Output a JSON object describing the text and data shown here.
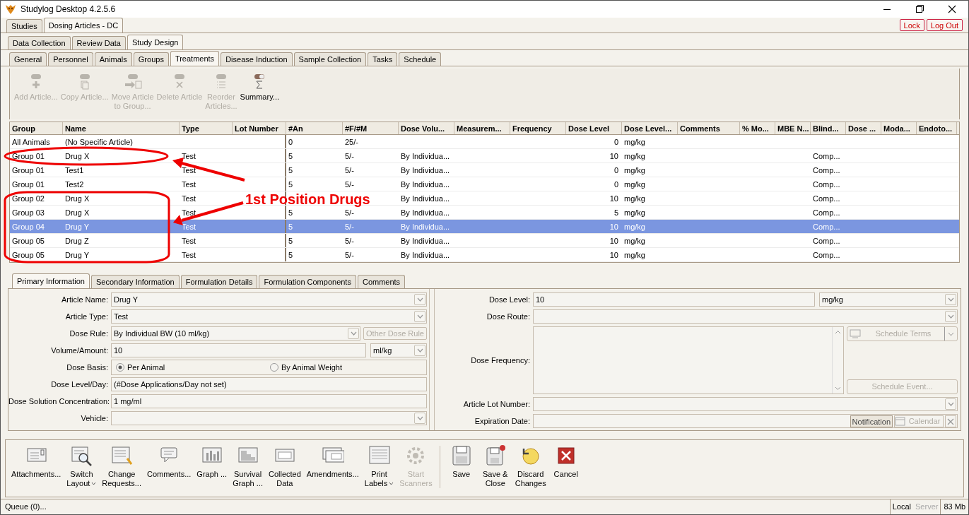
{
  "window": {
    "title": "Studylog Desktop 4.2.5.6"
  },
  "top_tabs": [
    {
      "label": "Studies",
      "selected": false
    },
    {
      "label": "Dosing Articles - DC",
      "selected": true
    }
  ],
  "session_buttons": [
    "Lock",
    "Log Out"
  ],
  "mode_tabs": [
    {
      "label": "Data Collection",
      "selected": false
    },
    {
      "label": "Review Data",
      "selected": false
    },
    {
      "label": "Study Design",
      "selected": true
    }
  ],
  "design_tabs": [
    {
      "label": "General",
      "selected": false
    },
    {
      "label": "Personnel",
      "selected": false
    },
    {
      "label": "Animals",
      "selected": false
    },
    {
      "label": "Groups",
      "selected": false
    },
    {
      "label": "Treatments",
      "selected": true
    },
    {
      "label": "Disease Induction",
      "selected": false
    },
    {
      "label": "Sample Collection",
      "selected": false
    },
    {
      "label": "Tasks",
      "selected": false
    },
    {
      "label": "Schedule",
      "selected": false
    }
  ],
  "toolbar": [
    {
      "label": [
        "Add Article..."
      ],
      "disabled": true
    },
    {
      "label": [
        "Copy Article..."
      ],
      "disabled": true
    },
    {
      "label": [
        "Move Article",
        "to Group..."
      ],
      "disabled": true
    },
    {
      "label": [
        "Delete Article"
      ],
      "disabled": true
    },
    {
      "label": [
        "Reorder",
        "Articles..."
      ],
      "disabled": true
    },
    {
      "label": [
        "Summary..."
      ],
      "disabled": false
    }
  ],
  "table": {
    "columns": [
      "Group",
      "Name",
      "Type",
      "Lot Number",
      "#An",
      "#F/#M",
      "Dose Volu...",
      "Measurem...",
      "Frequency",
      "Dose Level",
      "Dose Level...",
      "Comments",
      "% Mo...",
      "MBE N...",
      "Blind...",
      "Dose ...",
      "Moda...",
      "Endoto..."
    ],
    "rows": [
      {
        "selected": false,
        "cells": [
          "All Animals",
          "(No Specific Article)",
          "",
          "",
          "0",
          "25/-",
          "",
          "",
          "",
          "0",
          "mg/kg",
          "",
          "",
          "",
          "",
          "",
          "",
          ""
        ]
      },
      {
        "selected": false,
        "cells": [
          "Group 01",
          "Drug X",
          "Test",
          "",
          "5",
          "5/-",
          "By Individua...",
          "",
          "",
          "10",
          "mg/kg",
          "",
          "",
          "",
          "Comp...",
          "",
          "",
          ""
        ]
      },
      {
        "selected": false,
        "cells": [
          "Group 01",
          "Test1",
          "Test",
          "",
          "5",
          "5/-",
          "By Individua...",
          "",
          "",
          "0",
          "mg/kg",
          "",
          "",
          "",
          "Comp...",
          "",
          "",
          ""
        ]
      },
      {
        "selected": false,
        "cells": [
          "Group 01",
          "Test2",
          "Test",
          "",
          "5",
          "5/-",
          "By Individua...",
          "",
          "",
          "0",
          "mg/kg",
          "",
          "",
          "",
          "Comp...",
          "",
          "",
          ""
        ]
      },
      {
        "selected": false,
        "cells": [
          "Group 02",
          "Drug X",
          "Test",
          "",
          "",
          "",
          "By Individua...",
          "",
          "",
          "10",
          "mg/kg",
          "",
          "",
          "",
          "Comp...",
          "",
          "",
          ""
        ]
      },
      {
        "selected": false,
        "cells": [
          "Group 03",
          "Drug X",
          "Test",
          "",
          "5",
          "5/-",
          "By Individua...",
          "",
          "",
          "5",
          "mg/kg",
          "",
          "",
          "",
          "Comp...",
          "",
          "",
          ""
        ]
      },
      {
        "selected": true,
        "cells": [
          "Group 04",
          "Drug Y",
          "Test",
          "",
          "5",
          "5/-",
          "By Individua...",
          "",
          "",
          "10",
          "mg/kg",
          "",
          "",
          "",
          "Comp...",
          "",
          "",
          ""
        ]
      },
      {
        "selected": false,
        "cells": [
          "Group 05",
          "Drug Z",
          "Test",
          "",
          "5",
          "5/-",
          "By Individua...",
          "",
          "",
          "10",
          "mg/kg",
          "",
          "",
          "",
          "Comp...",
          "",
          "",
          ""
        ]
      },
      {
        "selected": false,
        "cells": [
          "Group 05",
          "Drug Y",
          "Test",
          "",
          "5",
          "5/-",
          "By Individua...",
          "",
          "",
          "10",
          "mg/kg",
          "",
          "",
          "",
          "Comp...",
          "",
          "",
          ""
        ]
      }
    ]
  },
  "detail_tabs": [
    {
      "label": "Primary Information",
      "selected": true
    },
    {
      "label": "Secondary Information",
      "selected": false
    },
    {
      "label": "Formulation Details",
      "selected": false
    },
    {
      "label": "Formulation Components",
      "selected": false
    },
    {
      "label": "Comments",
      "selected": false
    }
  ],
  "left_fields": [
    {
      "kind": "combo",
      "label": "Article Name:",
      "value": "Drug Y"
    },
    {
      "kind": "combo",
      "label": "Article Type:",
      "value": "Test"
    },
    {
      "kind": "combo_button",
      "label": "Dose Rule:",
      "value": "By Individual BW (10 ml/kg)",
      "button": "Other Dose Rule"
    },
    {
      "kind": "text_unit",
      "label": "Volume/Amount:",
      "value": "10",
      "unit": "ml/kg"
    },
    {
      "kind": "radio",
      "label": "Dose Basis:",
      "options": [
        {
          "label": "Per Animal",
          "selected": true
        },
        {
          "label": "By Animal Weight",
          "selected": false
        }
      ]
    },
    {
      "kind": "text",
      "label": "Dose Level/Day:",
      "value": "(#Dose Applications/Day not set)"
    },
    {
      "kind": "text",
      "label": "Dose Solution Concentration:",
      "value": "1 mg/ml"
    },
    {
      "kind": "combo",
      "label": "Vehicle:"
    }
  ],
  "right_fields": [
    {
      "kind": "text_unit",
      "label": "Dose Level:",
      "value": "10",
      "unit": "mg/kg"
    },
    {
      "kind": "combo",
      "label": "Dose Route:"
    },
    {
      "kind": "frequency",
      "label": "Dose Frequency:",
      "buttons": [
        "Schedule Terms",
        "Schedule Event..."
      ]
    },
    {
      "kind": "combo",
      "label": "Article Lot Number:"
    },
    {
      "kind": "date",
      "label": "Expiration Date:",
      "buttons": [
        "Notification",
        "Calendar"
      ]
    }
  ],
  "actions": [
    {
      "label": [
        "Attachments..."
      ],
      "disabled": false
    },
    {
      "label": [
        "Switch",
        "Layout"
      ],
      "dropdown": true,
      "disabled": false
    },
    {
      "label": [
        "Change",
        "Requests..."
      ],
      "disabled": false
    },
    {
      "label": [
        "Comments..."
      ],
      "disabled": false
    },
    {
      "label": [
        "Graph ..."
      ],
      "disabled": false
    },
    {
      "label": [
        "Survival",
        "Graph ..."
      ],
      "disabled": false
    },
    {
      "label": [
        "Collected",
        "Data"
      ],
      "disabled": false
    },
    {
      "label": [
        "Amendments..."
      ],
      "disabled": false
    },
    {
      "label": [
        "Print",
        "Labels"
      ],
      "dropdown": true,
      "disabled": false
    },
    {
      "label": [
        "Start",
        "Scanners"
      ],
      "disabled": true
    },
    {
      "label": [
        "Save"
      ],
      "disabled": false
    },
    {
      "label": [
        "Save &",
        "Close"
      ],
      "disabled": false
    },
    {
      "label": [
        "Discard",
        "Changes"
      ],
      "disabled": false
    },
    {
      "label": [
        "Cancel"
      ],
      "disabled": false
    }
  ],
  "status_bar": {
    "queue": "Queue (0)...",
    "connection": [
      {
        "label": "Local",
        "disabled": false
      },
      {
        "label": "Server",
        "disabled": true
      }
    ],
    "memory": "83 Mb"
  },
  "annotation": {
    "text": "1st Position Drugs"
  }
}
